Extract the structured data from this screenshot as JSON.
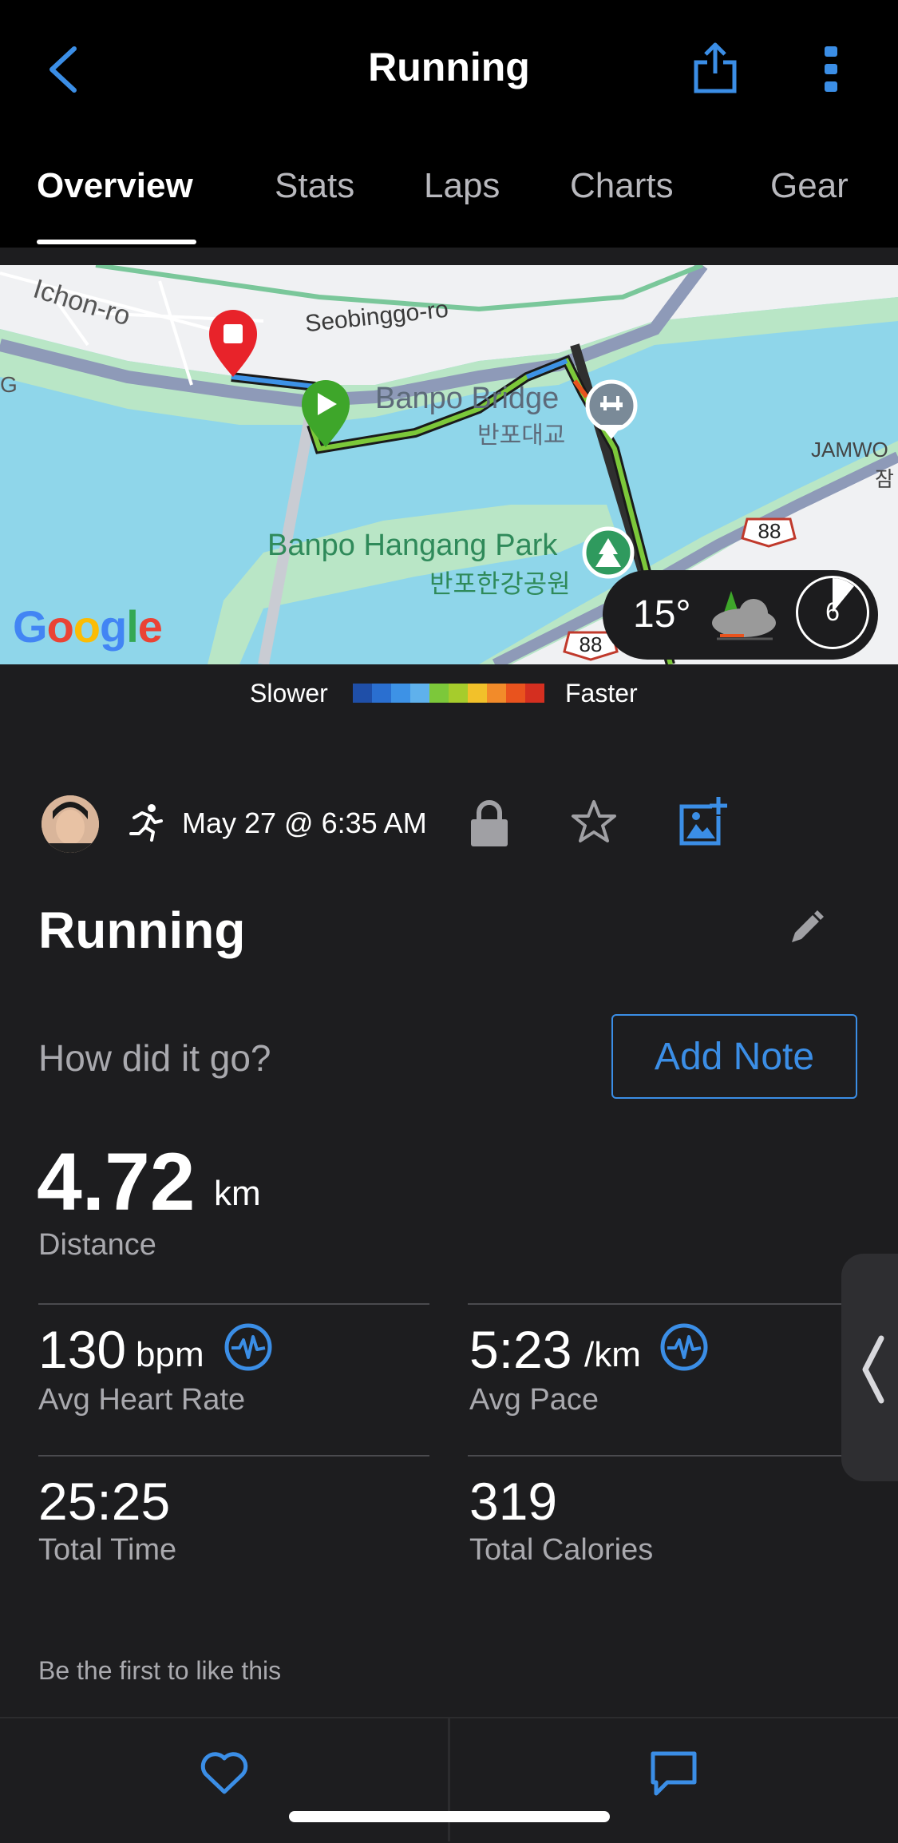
{
  "header": {
    "title": "Running",
    "back_icon": "chevron-left-icon",
    "share_icon": "share-icon",
    "more_icon": "more-vertical-icon"
  },
  "tabs": [
    {
      "label": "Overview",
      "active": true
    },
    {
      "label": "Stats",
      "active": false
    },
    {
      "label": "Laps",
      "active": false
    },
    {
      "label": "Charts",
      "active": false
    },
    {
      "label": "Gear",
      "active": false
    }
  ],
  "map": {
    "labels": {
      "ichon": "Ichon-ro",
      "seobinggo": "Seobinggo-ro",
      "bridge_en": "Banpo Bridge",
      "bridge_ko": "반포대교",
      "park_en": "Banpo Hangang Park",
      "park_ko": "반포한강공원",
      "jamwo": "JAMWO",
      "jamwo_ko": "잠",
      "g_left": "G",
      "route1": "88",
      "route2": "88",
      "google": "Google"
    },
    "weather": {
      "temp": "15°",
      "wind": "6"
    }
  },
  "legend": {
    "slower": "Slower",
    "faster": "Faster",
    "colors": [
      "#1f4fa8",
      "#2a6fd0",
      "#3d92e6",
      "#5fb1ec",
      "#7cc83a",
      "#a6cc2c",
      "#f2c12a",
      "#f28b2a",
      "#e9531e",
      "#d42f20"
    ]
  },
  "activity": {
    "date": "May 27 @ 6:35 AM",
    "title": "Running",
    "prompt": "How did it go?",
    "add_note": "Add Note"
  },
  "stats": {
    "distance": {
      "value": "4.72",
      "unit": "km",
      "label": "Distance"
    },
    "heart_rate": {
      "value": "130",
      "unit": "bpm",
      "label": "Avg Heart Rate"
    },
    "pace": {
      "value": "5:23",
      "unit": "/km",
      "label": "Avg Pace"
    },
    "total_time": {
      "value": "25:25",
      "label": "Total Time"
    },
    "calories": {
      "value": "319",
      "label": "Total Calories"
    }
  },
  "social": {
    "likes_text": "Be the first to like this"
  },
  "colors": {
    "accent": "#3b8ee6",
    "background": "#1d1d1f"
  }
}
